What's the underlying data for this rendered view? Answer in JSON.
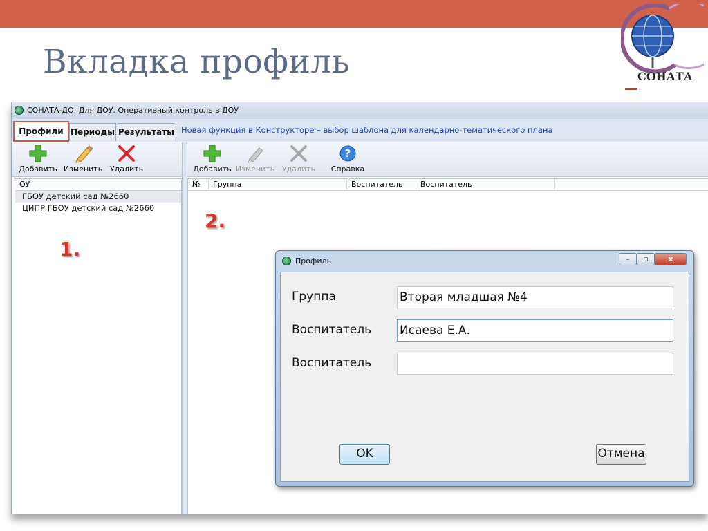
{
  "slide": {
    "title": "Вкладка профиль",
    "logo_text": "СОНАТА"
  },
  "app": {
    "title": "СОНАТА-ДО: Для ДОУ. Оперативный контроль в ДОУ",
    "tabs": [
      {
        "label": "Профили",
        "active": true
      },
      {
        "label": "Периоды",
        "active": false
      },
      {
        "label": "Результаты",
        "active": false
      }
    ],
    "news": "Новая функция в Конструкторе – выбор шаблона для календарно-тематического плана",
    "left_toolbar": {
      "add": "Добавить",
      "edit": "Изменить",
      "delete": "Удалить"
    },
    "right_toolbar": {
      "add": "Добавить",
      "edit": "Изменить",
      "delete": "Удалить",
      "help": "Справка"
    },
    "left_list": {
      "header": "ОУ",
      "rows": [
        "ГБОУ детский сад №2660",
        "ЦИПР ГБОУ детский сад №2660"
      ]
    },
    "grid": {
      "columns": [
        "№",
        "Группа",
        "Воспитатель",
        "Воспитатель"
      ]
    }
  },
  "markers": {
    "one": "1.",
    "two": "2."
  },
  "dialog": {
    "title": "Профиль",
    "fields": [
      {
        "label": "Группа",
        "value": "Вторая младшая №4"
      },
      {
        "label": "Воспитатель",
        "value": "Исаева Е.А."
      },
      {
        "label": "Воспитатель",
        "value": ""
      }
    ],
    "ok": "OK",
    "cancel": "Отмена",
    "window_buttons": {
      "minimize": "–",
      "maximize": "▫",
      "close": "x"
    }
  },
  "colors": {
    "topbar": "#d26149",
    "title": "#5b6b84",
    "accent": "#d0392b",
    "news_link": "#1f3fb8"
  }
}
